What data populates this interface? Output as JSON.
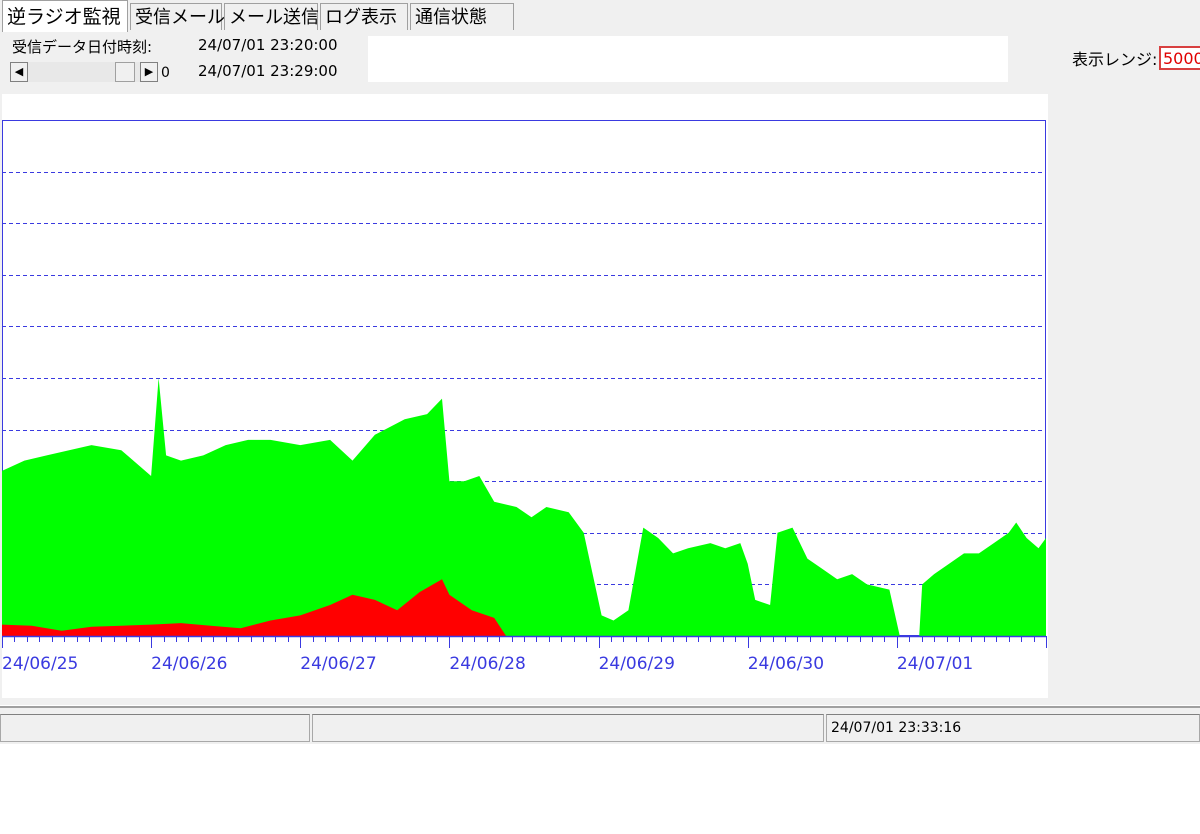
{
  "tabs": [
    "逆ラジオ監視",
    "受信メール",
    "メール送信",
    "ログ表示",
    "通信状態"
  ],
  "active_tab": 0,
  "receive": {
    "label": "受信データ日付時刻:",
    "time1": "24/07/01 23:20:00",
    "time2": "24/07/01 23:29:00",
    "scroll_value": "0"
  },
  "range": {
    "label": "表示レンジ:",
    "value": "5000"
  },
  "status": {
    "time": "24/07/01 23:33:16"
  },
  "colors": {
    "green": "#00ff00",
    "red": "#ff0000",
    "axis": "#3a3ae0",
    "grid": "#3a3ae0"
  },
  "chart_data": {
    "type": "area",
    "x_ticks": [
      "24/06/25",
      "24/06/26",
      "24/06/27",
      "24/06/28",
      "24/06/29",
      "24/06/30",
      "24/07/01"
    ],
    "x_range": [
      0,
      7
    ],
    "y_range": [
      0,
      10
    ],
    "grid": "horizontal dashed",
    "series": [
      {
        "color": "green",
        "points": [
          [
            0.0,
            3.2
          ],
          [
            0.15,
            3.4
          ],
          [
            0.3,
            3.5
          ],
          [
            0.45,
            3.6
          ],
          [
            0.6,
            3.7
          ],
          [
            0.8,
            3.6
          ],
          [
            1.0,
            3.1
          ],
          [
            1.05,
            5.0
          ],
          [
            1.1,
            3.5
          ],
          [
            1.2,
            3.4
          ],
          [
            1.35,
            3.5
          ],
          [
            1.5,
            3.7
          ],
          [
            1.65,
            3.8
          ],
          [
            1.8,
            3.8
          ],
          [
            2.0,
            3.7
          ],
          [
            2.2,
            3.8
          ],
          [
            2.35,
            3.4
          ],
          [
            2.5,
            3.9
          ],
          [
            2.7,
            4.2
          ],
          [
            2.85,
            4.3
          ],
          [
            2.95,
            4.6
          ],
          [
            3.0,
            3.0
          ],
          [
            3.1,
            3.0
          ],
          [
            3.2,
            3.1
          ],
          [
            3.3,
            2.6
          ],
          [
            3.45,
            2.5
          ],
          [
            3.55,
            2.3
          ],
          [
            3.65,
            2.5
          ],
          [
            3.8,
            2.4
          ],
          [
            3.9,
            2.0
          ],
          [
            4.02,
            0.4
          ],
          [
            4.1,
            0.3
          ],
          [
            4.2,
            0.5
          ],
          [
            4.3,
            2.1
          ],
          [
            4.4,
            1.9
          ],
          [
            4.5,
            1.6
          ],
          [
            4.6,
            1.7
          ],
          [
            4.75,
            1.8
          ],
          [
            4.85,
            1.7
          ],
          [
            4.95,
            1.8
          ],
          [
            5.0,
            1.4
          ],
          [
            5.05,
            0.7
          ],
          [
            5.15,
            0.6
          ],
          [
            5.2,
            2.0
          ],
          [
            5.3,
            2.1
          ],
          [
            5.4,
            1.5
          ],
          [
            5.5,
            1.3
          ],
          [
            5.6,
            1.1
          ],
          [
            5.7,
            1.2
          ],
          [
            5.8,
            1.0
          ],
          [
            5.95,
            0.9
          ],
          [
            6.02,
            0.0
          ],
          [
            6.15,
            0.0
          ],
          [
            6.17,
            1.0
          ],
          [
            6.25,
            1.2
          ],
          [
            6.35,
            1.4
          ],
          [
            6.45,
            1.6
          ],
          [
            6.55,
            1.6
          ],
          [
            6.65,
            1.8
          ],
          [
            6.75,
            2.0
          ],
          [
            6.8,
            2.2
          ],
          [
            6.87,
            1.9
          ],
          [
            6.95,
            1.7
          ],
          [
            7.0,
            1.9
          ]
        ]
      },
      {
        "color": "red",
        "points": [
          [
            0.0,
            0.22
          ],
          [
            0.2,
            0.2
          ],
          [
            0.4,
            0.1
          ],
          [
            0.6,
            0.18
          ],
          [
            0.8,
            0.2
          ],
          [
            1.0,
            0.22
          ],
          [
            1.2,
            0.25
          ],
          [
            1.4,
            0.2
          ],
          [
            1.6,
            0.15
          ],
          [
            1.8,
            0.3
          ],
          [
            2.0,
            0.4
          ],
          [
            2.2,
            0.6
          ],
          [
            2.35,
            0.8
          ],
          [
            2.5,
            0.7
          ],
          [
            2.65,
            0.5
          ],
          [
            2.8,
            0.85
          ],
          [
            2.95,
            1.1
          ],
          [
            3.0,
            0.8
          ],
          [
            3.15,
            0.5
          ],
          [
            3.3,
            0.35
          ],
          [
            3.38,
            0.0
          ]
        ]
      }
    ]
  }
}
